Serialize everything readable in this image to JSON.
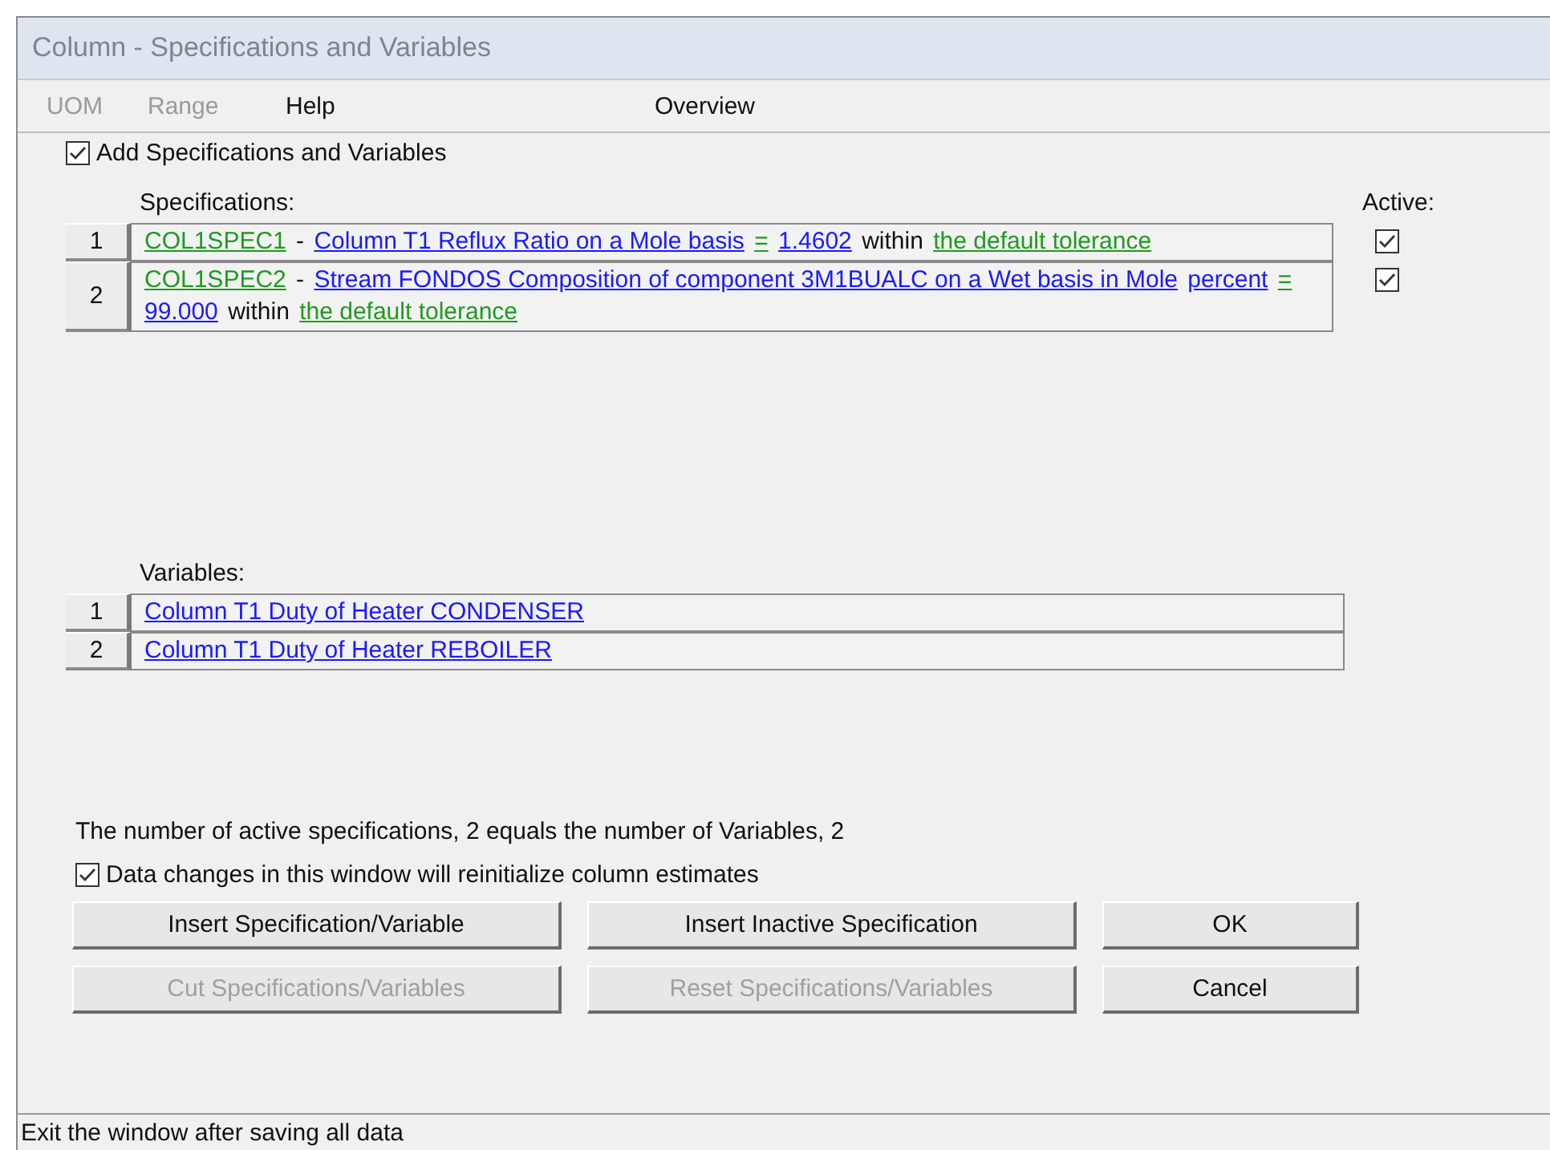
{
  "window": {
    "title": "Column - Specifications and Variables"
  },
  "menu": [
    {
      "label": "UOM",
      "disabled": true
    },
    {
      "label": "Range",
      "disabled": true
    },
    {
      "label": "Help",
      "disabled": false
    },
    {
      "label": "Overview",
      "disabled": false
    }
  ],
  "add_checkbox": {
    "label": "Add Specifications and Variables",
    "checked": true
  },
  "specifications": {
    "label": "Specifications:",
    "active_label": "Active:",
    "rows": [
      {
        "number": "1",
        "active": true,
        "parts": [
          {
            "kind": "name",
            "text": "COL1SPEC1"
          },
          {
            "kind": "plain",
            "text": "-"
          },
          {
            "kind": "link",
            "text": "Column T1 Reflux Ratio on a Mole basis"
          },
          {
            "kind": "name",
            "text": "="
          },
          {
            "kind": "link",
            "text": "1.4602"
          },
          {
            "kind": "plain",
            "text": "within"
          },
          {
            "kind": "name",
            "text": "the default tolerance"
          }
        ]
      },
      {
        "number": "2",
        "active": true,
        "parts": [
          {
            "kind": "name",
            "text": "COL1SPEC2"
          },
          {
            "kind": "plain",
            "text": "-"
          },
          {
            "kind": "link",
            "text": "Stream FONDOS Composition of component 3M1BUALC on a Wet basis in Mole"
          },
          {
            "kind": "link",
            "text": "percent"
          },
          {
            "kind": "name",
            "text": "="
          },
          {
            "kind": "link",
            "text": "99.000"
          },
          {
            "kind": "plain",
            "text": "within"
          },
          {
            "kind": "name",
            "text": "the default tolerance"
          }
        ]
      }
    ]
  },
  "variables": {
    "label": "Variables:",
    "rows": [
      {
        "number": "1",
        "text": "Column T1 Duty of Heater CONDENSER"
      },
      {
        "number": "2",
        "text": "Column T1 Duty of Heater REBOILER"
      }
    ]
  },
  "summary": "The number of active specifications, 2 equals the number of Variables, 2",
  "reinit_checkbox": {
    "label": "Data changes in this window will reinitialize column estimates",
    "checked": true
  },
  "buttons": [
    {
      "label": "Insert Specification/Variable",
      "disabled": false
    },
    {
      "label": "Insert Inactive Specification",
      "disabled": false
    },
    {
      "label": "OK",
      "disabled": false
    },
    {
      "label": "Cut Specifications/Variables",
      "disabled": true
    },
    {
      "label": "Reset Specifications/Variables",
      "disabled": true
    },
    {
      "label": "Cancel",
      "disabled": false
    }
  ],
  "status_bar": "Exit the window after saving all data"
}
